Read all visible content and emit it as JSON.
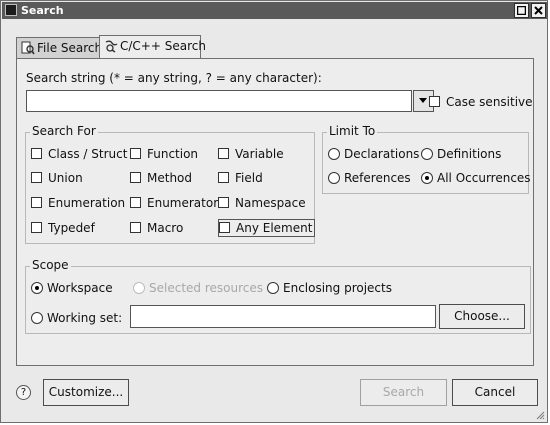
{
  "window": {
    "title": "Search"
  },
  "tabs": [
    {
      "label": "File Search",
      "icon": "file-search-icon"
    },
    {
      "label": "C/C++ Search",
      "icon": "cpp-search-icon"
    }
  ],
  "search_string": {
    "label": "Search string (* = any string, ? = any character):",
    "value": "",
    "case_sensitive_label": "Case sensitive",
    "case_sensitive": false
  },
  "search_for": {
    "title": "Search For",
    "options": [
      {
        "label": "Class / Struct",
        "checked": false
      },
      {
        "label": "Function",
        "checked": false
      },
      {
        "label": "Variable",
        "checked": false
      },
      {
        "label": "Union",
        "checked": false
      },
      {
        "label": "Method",
        "checked": false
      },
      {
        "label": "Field",
        "checked": false
      },
      {
        "label": "Enumeration",
        "checked": false
      },
      {
        "label": "Enumerator",
        "checked": false
      },
      {
        "label": "Namespace",
        "checked": false
      },
      {
        "label": "Typedef",
        "checked": false
      },
      {
        "label": "Macro",
        "checked": false
      },
      {
        "label": "Any Element",
        "checked": false
      }
    ]
  },
  "limit_to": {
    "title": "Limit To",
    "options": [
      {
        "label": "Declarations",
        "selected": false
      },
      {
        "label": "Definitions",
        "selected": false
      },
      {
        "label": "References",
        "selected": false
      },
      {
        "label": "All Occurrences",
        "selected": true
      }
    ]
  },
  "scope": {
    "title": "Scope",
    "workspace": "Workspace",
    "selected_resources": "Selected resources",
    "enclosing_projects": "Enclosing projects",
    "working_set": "Working set:",
    "working_set_value": "",
    "choose": "Choose...",
    "selected": "Workspace"
  },
  "footer": {
    "help": "?",
    "customize": "Customize...",
    "search": "Search",
    "cancel": "Cancel"
  }
}
